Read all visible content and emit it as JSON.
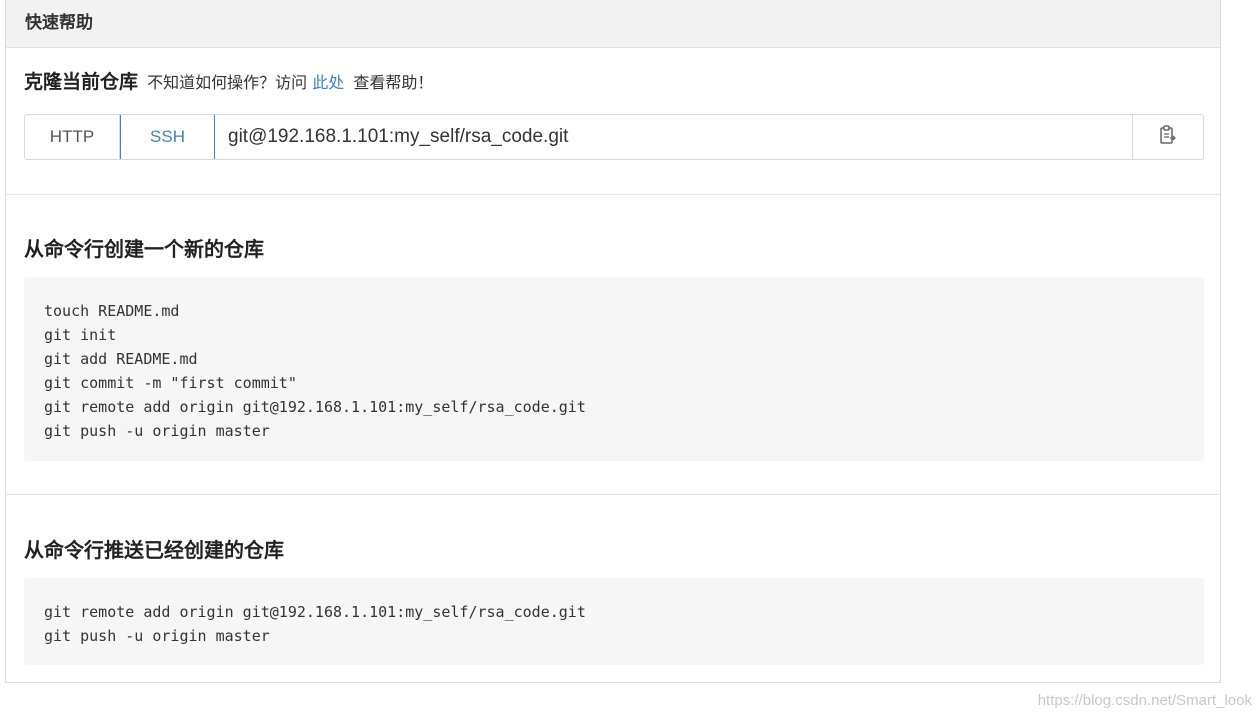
{
  "header": {
    "title": "快速帮助"
  },
  "clone": {
    "title": "克隆当前仓库",
    "hint_prefix": "不知道如何操作？访问",
    "hint_link": "此处",
    "hint_suffix": "查看帮助！",
    "protocols": [
      "HTTP",
      "SSH"
    ],
    "active_protocol": "SSH",
    "url": "git@192.168.1.101:my_self/rsa_code.git",
    "copy_icon": "clipboard-icon"
  },
  "new_repo": {
    "title": "从命令行创建一个新的仓库",
    "lines": [
      "touch README.md",
      "git init",
      "git add README.md",
      "git commit -m \"first commit\"",
      "git remote add origin git@192.168.1.101:my_self/rsa_code.git",
      "git push -u origin master"
    ]
  },
  "push_existing": {
    "title": "从命令行推送已经创建的仓库",
    "lines": [
      "git remote add origin git@192.168.1.101:my_self/rsa_code.git",
      "git push -u origin master"
    ]
  },
  "watermark": "https://blog.csdn.net/Smart_look",
  "colors": {
    "link": "#4183c4",
    "code_bg": "#f6f6f6",
    "header_bg": "#f2f2f2"
  }
}
